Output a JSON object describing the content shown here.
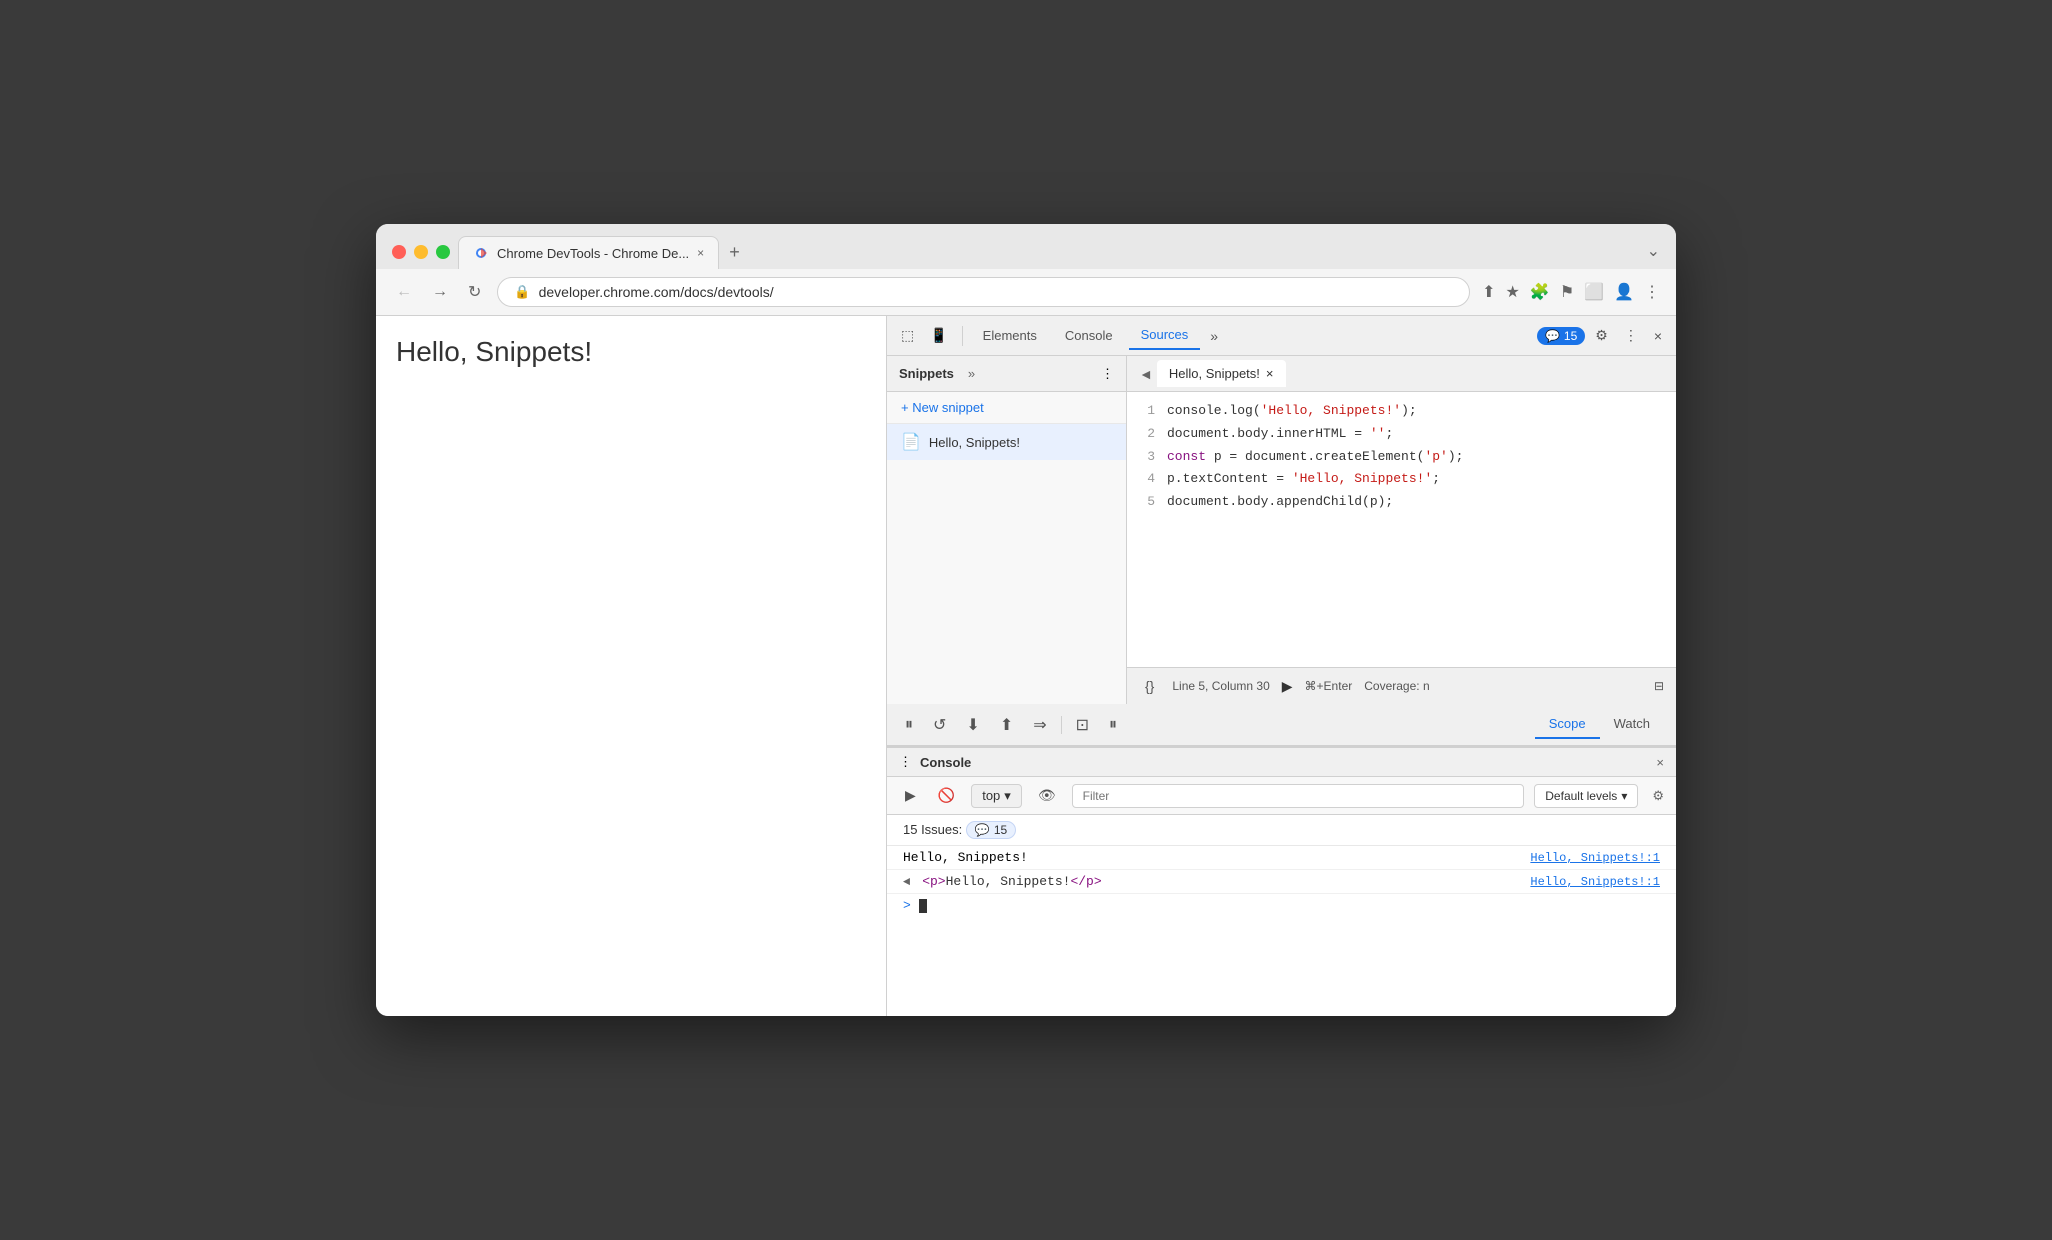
{
  "browser": {
    "traffic_lights": [
      "red",
      "yellow",
      "green"
    ],
    "tab": {
      "title": "Chrome DevTools - Chrome De...",
      "close_label": "×"
    },
    "new_tab_label": "+",
    "chevron_label": "⌄",
    "nav": {
      "back": "←",
      "forward": "→",
      "reload": "↻"
    },
    "url": "developer.chrome.com/docs/devtools/",
    "lock_icon": "🔒",
    "address_actions": [
      "⬆",
      "★",
      "🧩",
      "⚑",
      "⬜",
      "👤",
      "⋮"
    ]
  },
  "page": {
    "content": "Hello, Snippets!"
  },
  "devtools": {
    "inspector_icon": "⬚",
    "device_icon": "📱",
    "tabs": [
      "Elements",
      "Console",
      "Sources"
    ],
    "active_tab": "Sources",
    "more_tabs": "»",
    "badge": {
      "icon": "💬",
      "count": "15"
    },
    "settings_icon": "⚙",
    "more_icon": "⋮",
    "close_icon": "×"
  },
  "snippets_panel": {
    "title": "Snippets",
    "more_icon": "»",
    "menu_icon": "⋮",
    "new_snippet_label": "+ New snippet",
    "items": [
      {
        "name": "Hello, Snippets!",
        "active": true
      }
    ]
  },
  "code_editor": {
    "back_btn": "◄",
    "tab_title": "Hello, Snippets!",
    "tab_close": "×",
    "lines": [
      {
        "num": "1",
        "code": "console.log('Hello, Snippets!');"
      },
      {
        "num": "2",
        "code": "document.body.innerHTML = '';"
      },
      {
        "num": "3",
        "code": "const p = document.createElement('p');"
      },
      {
        "num": "4",
        "code": "p.textContent = 'Hello, Snippets!';"
      },
      {
        "num": "5",
        "code": "document.body.appendChild(p);"
      }
    ],
    "status": {
      "format_icon": "{}",
      "position": "Line 5, Column 30",
      "run_icon": "▶",
      "run_shortcut": "⌘+Enter",
      "coverage": "Coverage: n",
      "expand_icon": "⊟"
    }
  },
  "debugger": {
    "pause_btn": "⏸",
    "step_over": "↺",
    "step_into": "⬇",
    "step_out": "⬆",
    "step_next": "⇒",
    "breakpoints_icon": "⊡",
    "pause2_icon": "⏸",
    "tabs": [
      "Scope",
      "Watch"
    ],
    "active_tab": "Scope"
  },
  "console": {
    "more_icon": "⋮",
    "title": "Console",
    "close_icon": "×",
    "toolbar": {
      "execute_icon": "▶",
      "block_icon": "🚫",
      "top_label": "top",
      "dropdown_icon": "▾",
      "eye_icon": "👁",
      "filter_placeholder": "Filter",
      "levels_label": "Default levels",
      "levels_icon": "▾",
      "gear_icon": "⚙"
    },
    "issues": {
      "label": "15 Issues:",
      "icon": "💬",
      "count": "15"
    },
    "output": [
      {
        "type": "log",
        "text": "Hello, Snippets!",
        "source": "Hello, Snippets!:1"
      },
      {
        "type": "node",
        "arrow": "◄",
        "text": "<p>Hello, Snippets!</p>",
        "source": "Hello, Snippets!:1"
      }
    ],
    "input_prompt": ">",
    "input_cursor": "|"
  }
}
